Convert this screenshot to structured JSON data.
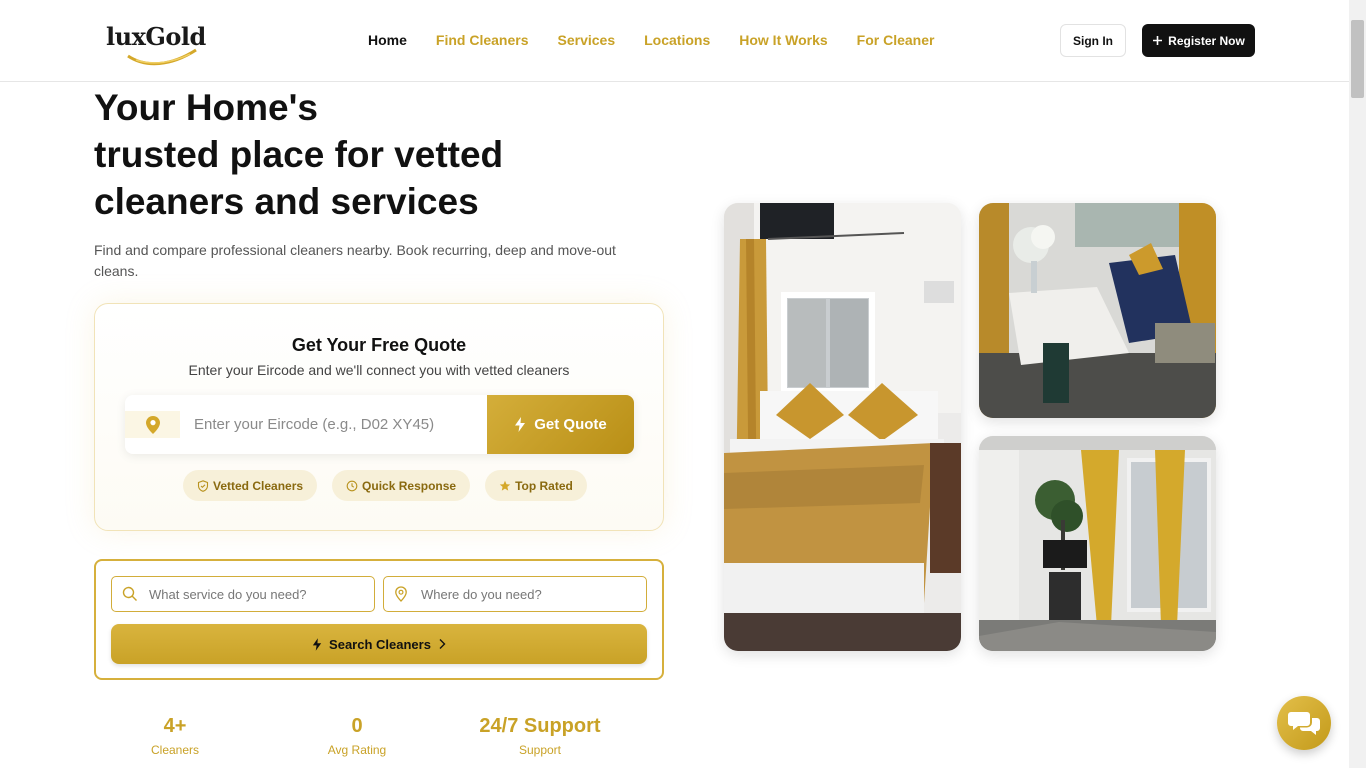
{
  "brand": {
    "logo_text": "luxGold"
  },
  "nav": {
    "items": [
      {
        "label": "Home",
        "active": true
      },
      {
        "label": "Find Cleaners",
        "active": false
      },
      {
        "label": "Services",
        "active": false
      },
      {
        "label": "Locations",
        "active": false
      },
      {
        "label": "How It Works",
        "active": false
      },
      {
        "label": "For Cleaner",
        "active": false
      }
    ],
    "signin_label": "Sign In",
    "register_label": "Register Now"
  },
  "hero": {
    "title_line1": "Your Home's",
    "title_line2": "trusted place for vetted",
    "title_line3": "cleaners and services",
    "subtitle": "Find and compare professional cleaners nearby. Book recurring, deep and move-out cleans."
  },
  "quote": {
    "title": "Get Your Free Quote",
    "subtitle": "Enter your Eircode and we'll connect you with vetted cleaners",
    "eircode_placeholder": "Enter your Eircode (e.g., D02 XY45)",
    "eircode_value": "",
    "button_label": "Get Quote",
    "badges": [
      {
        "label": "Vetted Cleaners",
        "icon": "shield-check-icon"
      },
      {
        "label": "Quick Response",
        "icon": "clock-icon"
      },
      {
        "label": "Top Rated",
        "icon": "star-icon"
      }
    ]
  },
  "search": {
    "service_placeholder": "What service do you need?",
    "location_placeholder": "Where do you need?",
    "button_label": "Search Cleaners"
  },
  "stats": [
    {
      "value": "4+",
      "label": "Cleaners"
    },
    {
      "value": "0",
      "label": "Avg Rating"
    },
    {
      "value": "24/7 Support",
      "label": "Support"
    }
  ],
  "colors": {
    "accent_gold": "#c9a227",
    "dark": "#111111"
  }
}
